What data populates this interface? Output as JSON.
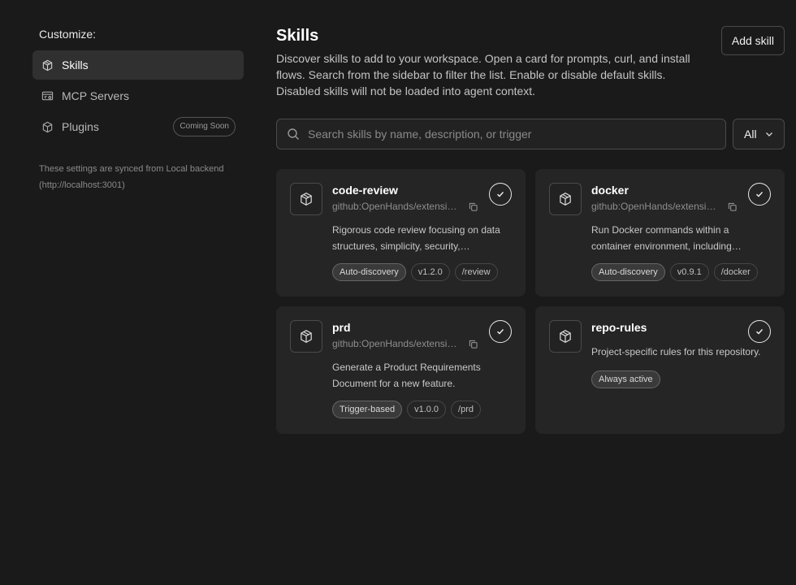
{
  "sidebar": {
    "customize_label": "Customize:",
    "items": [
      {
        "label": "Skills",
        "icon": "cube-icon",
        "active": true
      },
      {
        "label": "MCP Servers",
        "icon": "server-icon",
        "active": false
      },
      {
        "label": "Plugins",
        "icon": "package-icon",
        "active": false,
        "badge": "Coming Soon"
      }
    ],
    "sync_note_line1": "These settings are synced from Local backend",
    "sync_note_line2": "(http://localhost:3001)"
  },
  "main": {
    "title": "Skills",
    "description": "Discover skills to add to your workspace. Open a card for prompts, curl, and install flows. Search from the sidebar to filter the list. Enable or disable default skills. Disabled skills will not be loaded into agent context.",
    "add_button": "Add skill",
    "search_placeholder": "Search skills by name, description, or trigger",
    "filter_value": "All"
  },
  "cards": [
    {
      "name": "code-review",
      "source": "github:OpenHands/extensions",
      "description": "Rigorous code review focusing on data structures, simplicity, security,…",
      "tags": [
        "Auto-discovery",
        "v1.2.0",
        "/review"
      ],
      "enabled": true
    },
    {
      "name": "docker",
      "source": "github:OpenHands/extensions",
      "description": "Run Docker commands within a container environment, including starting…",
      "tags": [
        "Auto-discovery",
        "v0.9.1",
        "/docker"
      ],
      "enabled": true
    },
    {
      "name": "prd",
      "source": "github:OpenHands/extensions",
      "description": "Generate a Product Requirements Document for a new feature.",
      "tags": [
        "Trigger-based",
        "v1.0.0",
        "/prd"
      ],
      "enabled": true
    },
    {
      "name": "repo-rules",
      "source": "",
      "description": "Project-specific rules for this repository.",
      "tags": [
        "Always active"
      ],
      "enabled": true
    }
  ],
  "colors": {
    "background": "#1a1a1a",
    "card": "#252525",
    "active_nav": "#303030",
    "border": "#4a4a4a"
  }
}
